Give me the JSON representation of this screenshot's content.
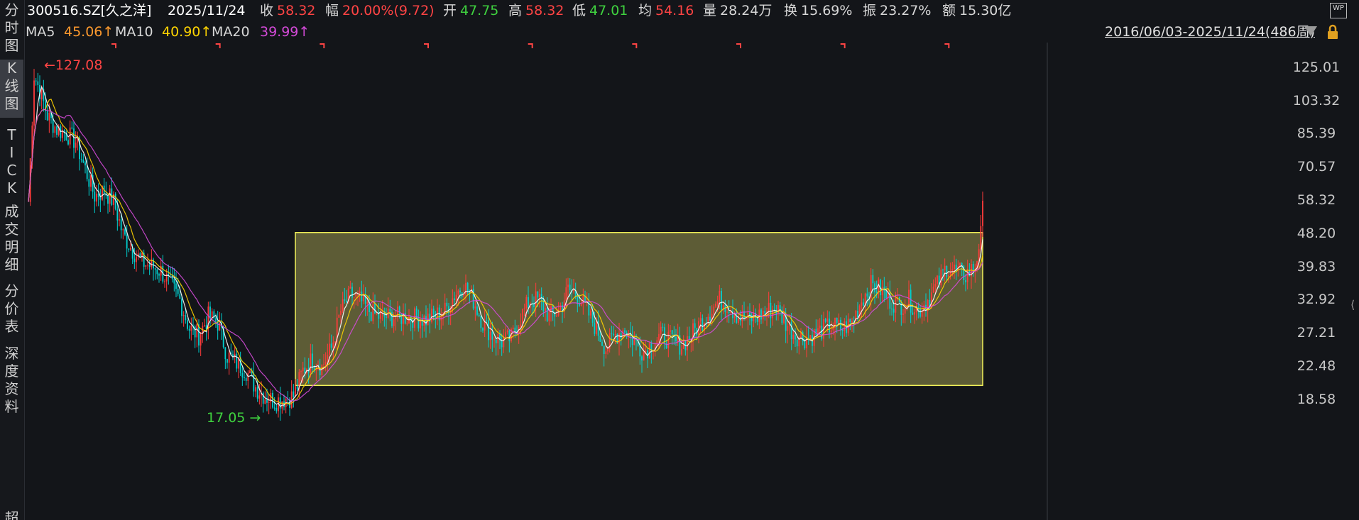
{
  "header": {
    "code": "300516.SZ[久之洋]",
    "date": "2025/11/24",
    "close_label": "收",
    "close": "58.32",
    "range_label": "幅",
    "range": "20.00%(9.72)",
    "open_label": "开",
    "open": "47.75",
    "high_label": "高",
    "high": "58.32",
    "low_label": "低",
    "low": "47.01",
    "avg_label": "均",
    "avg": "54.16",
    "vol_label": "量",
    "vol": "28.24万",
    "turnover_label": "换",
    "turnover": "15.69%",
    "amplitude_label": "振",
    "amplitude": "23.27%",
    "amount_label": "额",
    "amount": "15.30亿"
  },
  "ma": {
    "ma5_label": "MA5",
    "ma5": "45.06↑",
    "ma10_label": "MA10",
    "ma10": "40.90↑",
    "ma20_label": "MA20",
    "ma20": "39.99↑"
  },
  "date_range": "2016/06/03-2025/11/24(486周)",
  "wp_badge": "WP",
  "sidebar": {
    "tabs": [
      {
        "label": "分时图",
        "chars": [
          "分",
          "时",
          "图"
        ]
      },
      {
        "label": "K线图",
        "chars": [
          "K",
          "线",
          "图"
        ]
      },
      {
        "label": "TICK",
        "chars": [
          "T",
          "I",
          "C",
          "K"
        ]
      },
      {
        "label": "成交明细",
        "chars": [
          "成",
          "交",
          "明",
          "细"
        ]
      },
      {
        "label": "分价表",
        "chars": [
          "分",
          "价",
          "表"
        ]
      },
      {
        "label": "深度资料",
        "chars": [
          "深",
          "度",
          "资",
          "料"
        ]
      },
      {
        "label": "超",
        "chars": [
          "超"
        ]
      }
    ]
  },
  "annotations": {
    "max": "127.08",
    "min": "17.05"
  },
  "colors": {
    "up": "#ff3b3b",
    "down": "#00d0d0",
    "ma5": "#ffffff",
    "ma10": "#ffd400",
    "ma20": "#d44ad8",
    "box_fill": "#66643a",
    "box_border": "#f2f25a",
    "green_text": "#3fd13f",
    "red_text": "#ff4444",
    "ma5_text": "#ff9a2e",
    "ma10_text": "#ffd400",
    "ma20_text": "#d44ad8"
  },
  "yaxis": {
    "ticks": [
      "125.01",
      "103.32",
      "85.39",
      "70.57",
      "58.32",
      "48.20",
      "39.83",
      "32.92",
      "27.21",
      "22.48",
      "18.58"
    ],
    "log_scale": true
  },
  "chart_data": {
    "type": "candlestick",
    "price_range": [
      16.5,
      128
    ],
    "series": [
      {
        "name": "MA5"
      },
      {
        "name": "MA10"
      },
      {
        "name": "MA20"
      }
    ],
    "x_index_range": [
      0,
      486
    ],
    "close_path": [
      [
        0,
        58
      ],
      [
        3,
        120
      ],
      [
        6,
        110
      ],
      [
        10,
        95
      ],
      [
        15,
        88
      ],
      [
        20,
        86
      ],
      [
        25,
        82
      ],
      [
        30,
        70
      ],
      [
        35,
        60
      ],
      [
        40,
        62
      ],
      [
        45,
        58
      ],
      [
        50,
        48
      ],
      [
        55,
        44
      ],
      [
        60,
        41
      ],
      [
        65,
        40
      ],
      [
        70,
        39
      ],
      [
        75,
        36
      ],
      [
        80,
        33
      ],
      [
        85,
        28
      ],
      [
        90,
        27
      ],
      [
        95,
        30
      ],
      [
        100,
        29
      ],
      [
        105,
        24
      ],
      [
        110,
        23
      ],
      [
        115,
        22
      ],
      [
        120,
        20
      ],
      [
        125,
        19
      ],
      [
        130,
        18.5
      ],
      [
        135,
        18.7
      ],
      [
        140,
        19
      ],
      [
        145,
        22
      ],
      [
        150,
        23.5
      ],
      [
        155,
        22.5
      ],
      [
        160,
        25
      ],
      [
        165,
        31
      ],
      [
        170,
        34
      ],
      [
        175,
        33
      ],
      [
        180,
        31
      ],
      [
        185,
        30
      ],
      [
        190,
        30
      ],
      [
        200,
        30
      ],
      [
        210,
        29.5
      ],
      [
        220,
        31
      ],
      [
        225,
        34
      ],
      [
        230,
        36
      ],
      [
        235,
        33
      ],
      [
        240,
        29
      ],
      [
        245,
        27
      ],
      [
        250,
        26
      ],
      [
        255,
        26.5
      ],
      [
        260,
        30
      ],
      [
        265,
        33
      ],
      [
        270,
        33
      ],
      [
        275,
        30
      ],
      [
        280,
        31
      ],
      [
        285,
        35
      ],
      [
        290,
        34
      ],
      [
        295,
        31
      ],
      [
        300,
        28
      ],
      [
        305,
        25
      ],
      [
        310,
        27
      ],
      [
        315,
        28
      ],
      [
        320,
        26
      ],
      [
        325,
        24.5
      ],
      [
        330,
        26
      ],
      [
        335,
        27
      ],
      [
        340,
        26
      ],
      [
        345,
        25.5
      ],
      [
        350,
        27
      ],
      [
        355,
        29
      ],
      [
        360,
        31
      ],
      [
        365,
        33
      ],
      [
        370,
        32
      ],
      [
        375,
        30
      ],
      [
        380,
        29.5
      ],
      [
        385,
        30
      ],
      [
        390,
        31
      ],
      [
        395,
        31.5
      ],
      [
        400,
        29
      ],
      [
        405,
        27
      ],
      [
        410,
        26.5
      ],
      [
        415,
        27
      ],
      [
        420,
        28
      ],
      [
        425,
        28.5
      ],
      [
        430,
        28
      ],
      [
        435,
        29
      ],
      [
        440,
        33
      ],
      [
        445,
        36
      ],
      [
        450,
        35
      ],
      [
        455,
        33
      ],
      [
        460,
        32
      ],
      [
        465,
        33
      ],
      [
        470,
        31
      ],
      [
        475,
        33
      ],
      [
        480,
        36
      ],
      [
        485,
        40
      ],
      [
        490,
        39
      ],
      [
        495,
        38
      ],
      [
        500,
        40
      ],
      [
        503,
        48
      ],
      [
        504,
        58.32
      ]
    ],
    "box": {
      "x_start": 141,
      "x_end": 504,
      "price_low": 20.2,
      "price_high": 48.6
    },
    "week_markers": [
      45,
      100,
      155,
      210,
      265,
      320,
      375,
      430,
      485
    ],
    "max_annotation": {
      "value": 127.08,
      "label": "127.08"
    },
    "min_annotation": {
      "value": 17.05,
      "label": "17.05"
    }
  }
}
